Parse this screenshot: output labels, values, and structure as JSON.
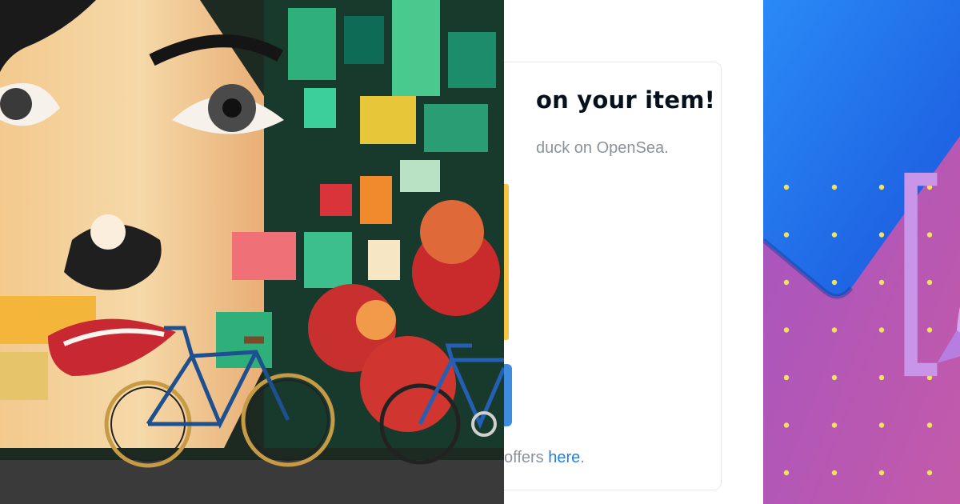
{
  "card": {
    "title": "on your item!",
    "subtitle": "duck on OpenSea.",
    "footer_prefix": "offers ",
    "footer_link": "here",
    "footer_suffix": "."
  },
  "panels": {
    "mural": "mural-photo",
    "tile": "gradient-tile",
    "logo_icon": "rocket-logo-icon"
  },
  "colors": {
    "link": "#2081e2",
    "title": "#04111d",
    "muted": "#8a939b",
    "accent_gold": "#f5c542",
    "accent_blue": "#3e8ce0",
    "tile_blue": "#1b6fe8",
    "tile_magenta": "#b656b5",
    "dot_yellow": "#f2e35c"
  }
}
